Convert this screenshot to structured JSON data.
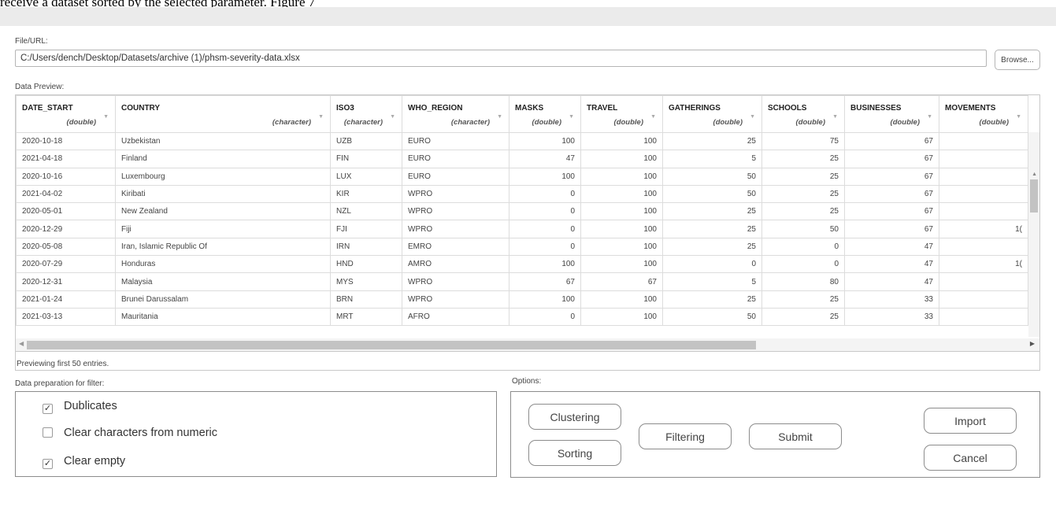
{
  "caption": "receive a dataset sorted by the selected parameter. Figure 7",
  "file_label": "File/URL:",
  "file_path": "C:/Users/dench/Desktop/Datasets/archive (1)/phsm-severity-data.xlsx",
  "browse_label": "Browse...",
  "preview_label": "Data Preview:",
  "columns": [
    {
      "name": "DATE_START",
      "type": "(double)"
    },
    {
      "name": "COUNTRY",
      "type": "(character)"
    },
    {
      "name": "ISO3",
      "type": "(character)"
    },
    {
      "name": "WHO_REGION",
      "type": "(character)"
    },
    {
      "name": "MASKS",
      "type": "(double)"
    },
    {
      "name": "TRAVEL",
      "type": "(double)"
    },
    {
      "name": "GATHERINGS",
      "type": "(double)"
    },
    {
      "name": "SCHOOLS",
      "type": "(double)"
    },
    {
      "name": "BUSINESSES",
      "type": "(double)"
    },
    {
      "name": "MOVEMENTS",
      "type": "(double)"
    }
  ],
  "rows": [
    [
      "2020-10-18",
      "Uzbekistan",
      "UZB",
      "EURO",
      "100",
      "100",
      "25",
      "75",
      "67",
      ""
    ],
    [
      "2021-04-18",
      "Finland",
      "FIN",
      "EURO",
      "47",
      "100",
      "5",
      "25",
      "67",
      ""
    ],
    [
      "2020-10-16",
      "Luxembourg",
      "LUX",
      "EURO",
      "100",
      "100",
      "50",
      "25",
      "67",
      ""
    ],
    [
      "2021-04-02",
      "Kiribati",
      "KIR",
      "WPRO",
      "0",
      "100",
      "50",
      "25",
      "67",
      ""
    ],
    [
      "2020-05-01",
      "New Zealand",
      "NZL",
      "WPRO",
      "0",
      "100",
      "25",
      "25",
      "67",
      ""
    ],
    [
      "2020-12-29",
      "Fiji",
      "FJI",
      "WPRO",
      "0",
      "100",
      "25",
      "50",
      "67",
      "1("
    ],
    [
      "2020-05-08",
      "Iran, Islamic Republic Of",
      "IRN",
      "EMRO",
      "0",
      "100",
      "25",
      "0",
      "47",
      ""
    ],
    [
      "2020-07-29",
      "Honduras",
      "HND",
      "AMRO",
      "100",
      "100",
      "0",
      "0",
      "47",
      "1("
    ],
    [
      "2020-12-31",
      "Malaysia",
      "MYS",
      "WPRO",
      "67",
      "67",
      "5",
      "80",
      "47",
      ""
    ],
    [
      "2021-01-24",
      "Brunei Darussalam",
      "BRN",
      "WPRO",
      "100",
      "100",
      "25",
      "25",
      "33",
      ""
    ],
    [
      "2021-03-13",
      "Mauritania",
      "MRT",
      "AFRO",
      "0",
      "100",
      "50",
      "25",
      "33",
      ""
    ]
  ],
  "preview_footer": "Previewing first 50 entries.",
  "prep_label": "Data preparation for filter:",
  "prep_options": [
    {
      "label": "Dublicates",
      "checked": true
    },
    {
      "label": "Clear characters from numeric",
      "checked": false
    },
    {
      "label": "Clear empty",
      "checked": true
    }
  ],
  "options_label": "Options:",
  "buttons": {
    "clustering": "Clustering",
    "sorting": "Sorting",
    "filtering": "Filtering",
    "submit": "Submit",
    "import": "Import",
    "cancel": "Cancel"
  }
}
